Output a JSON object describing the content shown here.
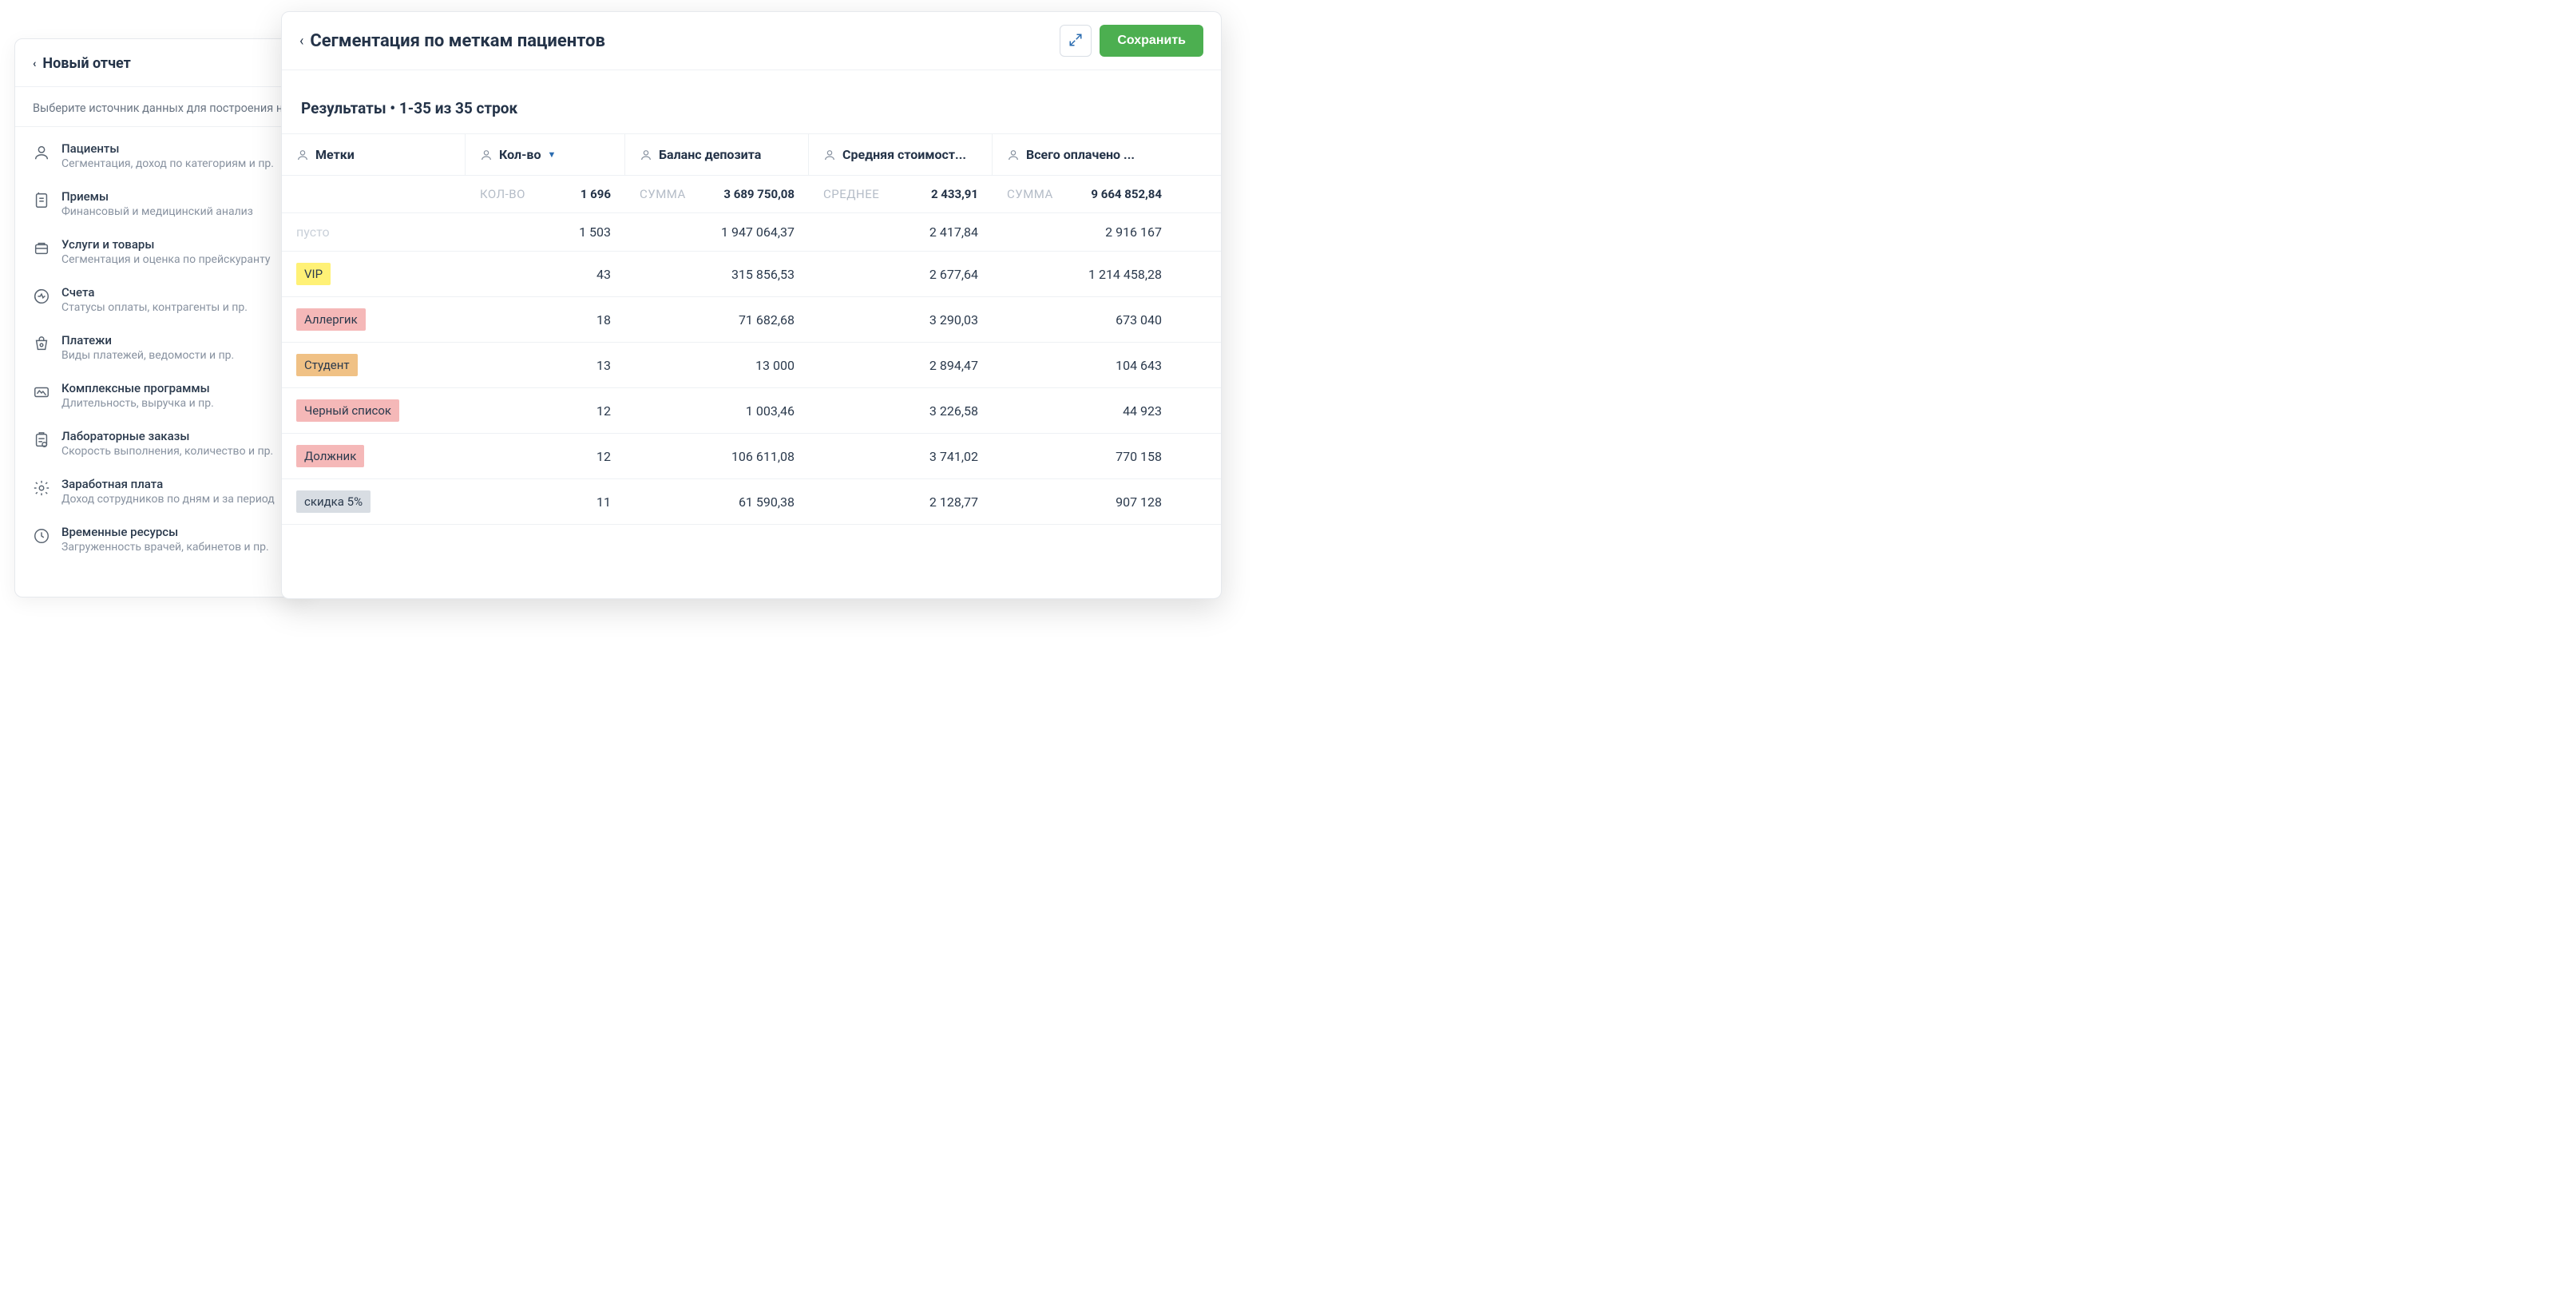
{
  "bg": {
    "title": "Новый отчет",
    "sub": "Выберите источник данных для построения н",
    "items": [
      {
        "title": "Пациенты",
        "desc": "Сегментация, доход по категориям и пр."
      },
      {
        "title": "Приемы",
        "desc": "Финансовый и медицинский анализ"
      },
      {
        "title": "Услуги и товары",
        "desc": "Сегментация и оценка по прейскуранту"
      },
      {
        "title": "Счета",
        "desc": "Статусы оплаты, контрагенты и пр."
      },
      {
        "title": "Платежи",
        "desc": "Виды платежей, ведомости и пр."
      },
      {
        "title": "Комплексные программы",
        "desc": "Длительность, выручка и пр."
      },
      {
        "title": "Лабораторные заказы",
        "desc": "Скорость выполнения, количество и пр."
      },
      {
        "title": "Заработная плата",
        "desc": "Доход сотрудников по дням и за период"
      },
      {
        "title": "Временные ресурсы",
        "desc": "Загруженность врачей, кабинетов и пр."
      }
    ]
  },
  "fg": {
    "title": "Сегментация по меткам пациентов",
    "save": "Сохранить",
    "results_label": "Результаты • 1-35 из 35 строк",
    "columns": {
      "c0": "Метки",
      "c1": "Кол-во",
      "c2": "Баланс депозита",
      "c3": "Средняя стоимост...",
      "c4": "Всего оплачено ..."
    },
    "summary": {
      "c1_label": "КОЛ-ВО",
      "c1_val": "1 696",
      "c2_label": "СУММА",
      "c2_val": "3 689 750,08",
      "c3_label": "СРЕДНЕЕ",
      "c3_val": "2 433,91",
      "c4_label": "СУММА",
      "c4_val": "9 664 852,84"
    },
    "rows": [
      {
        "tag": "пусто",
        "tag_class": "empty",
        "count": "1 503",
        "balance": "1 947 064,37",
        "avg": "2 417,84",
        "paid": "2 916 167"
      },
      {
        "tag": "VIP",
        "tag_class": "tag-yellow",
        "count": "43",
        "balance": "315 856,53",
        "avg": "2 677,64",
        "paid": "1 214 458,28"
      },
      {
        "tag": "Аллергик",
        "tag_class": "tag-pink",
        "count": "18",
        "balance": "71 682,68",
        "avg": "3 290,03",
        "paid": "673 040"
      },
      {
        "tag": "Студент",
        "tag_class": "tag-orange",
        "count": "13",
        "balance": "13 000",
        "avg": "2 894,47",
        "paid": "104 643"
      },
      {
        "tag": "Черный список",
        "tag_class": "tag-pink",
        "count": "12",
        "balance": "1 003,46",
        "avg": "3 226,58",
        "paid": "44 923"
      },
      {
        "tag": "Должник",
        "tag_class": "tag-pink",
        "count": "12",
        "balance": "106 611,08",
        "avg": "3 741,02",
        "paid": "770 158"
      },
      {
        "tag": "скидка 5%",
        "tag_class": "tag-grey",
        "count": "11",
        "balance": "61 590,38",
        "avg": "2 128,77",
        "paid": "907 128"
      }
    ]
  }
}
